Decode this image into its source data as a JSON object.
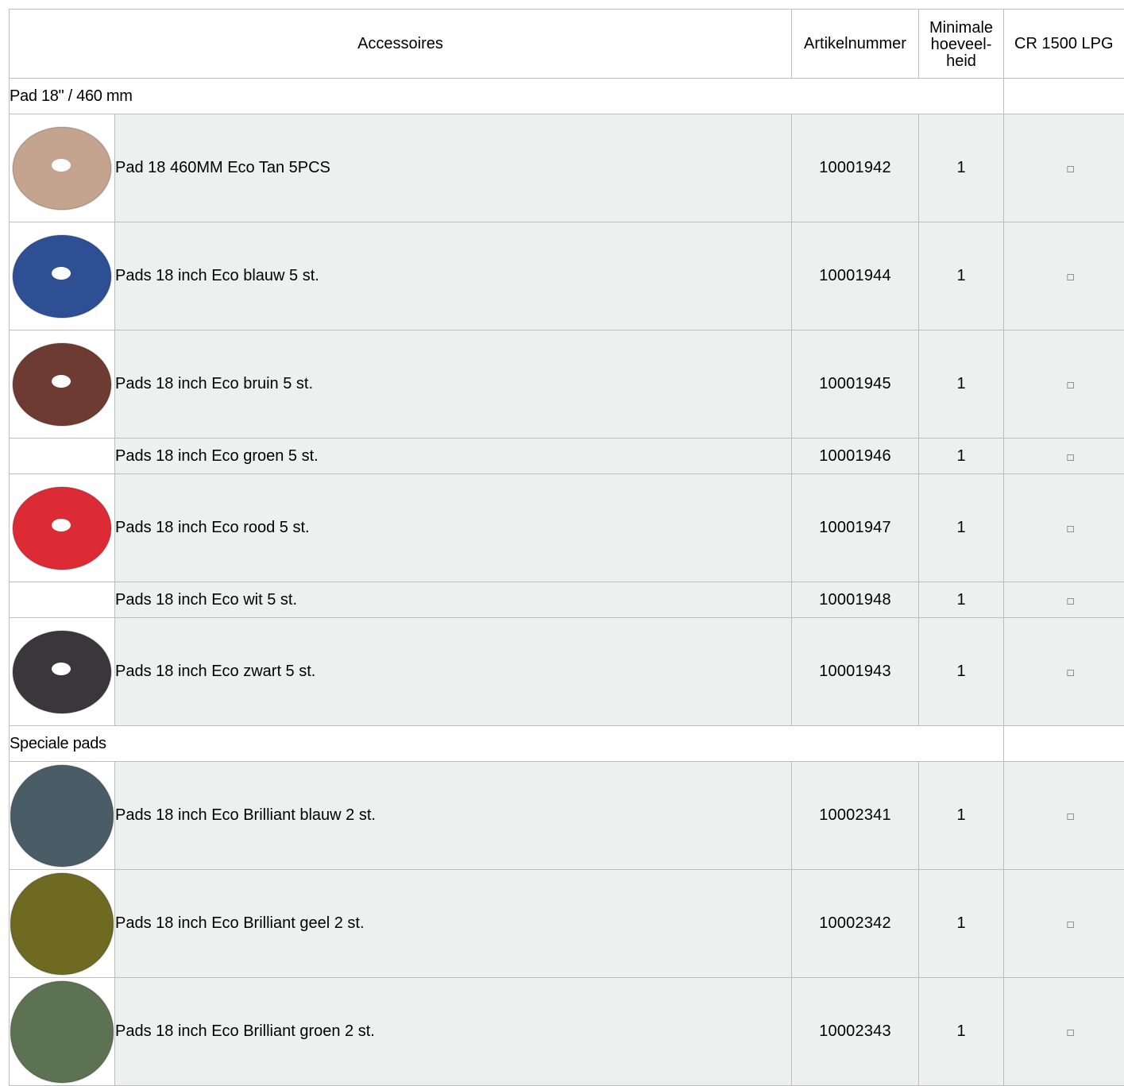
{
  "table": {
    "headers": {
      "accessories": "Accessoires",
      "article_number": "Artikelnummer",
      "min_qty": "Minimale hoeveel-heid",
      "model": "CR 1500 LPG"
    },
    "sections": [
      {
        "title": "Pad 18\" / 460 mm",
        "items": [
          {
            "description": "Pad 18 460MM  Eco Tan 5PCS",
            "article": "10001942",
            "qty": "1",
            "mark": "□",
            "pad_color": "#c4a38f",
            "has_image": true,
            "hole": true
          },
          {
            "description": "Pads 18 inch Eco blauw 5 st.",
            "article": "10001944",
            "qty": "1",
            "mark": "□",
            "pad_color": "#2f4f95",
            "has_image": true,
            "hole": true
          },
          {
            "description": "Pads 18 inch Eco bruin 5 st.",
            "article": "10001945",
            "qty": "1",
            "mark": "□",
            "pad_color": "#6e3b32",
            "has_image": true,
            "hole": true
          },
          {
            "description": "Pads 18 inch Eco groen 5 st.",
            "article": "10001946",
            "qty": "1",
            "mark": "□",
            "pad_color": "",
            "has_image": false,
            "hole": false
          },
          {
            "description": "Pads 18 inch Eco rood 5 st.",
            "article": "10001947",
            "qty": "1",
            "mark": "□",
            "pad_color": "#dc2b35",
            "has_image": true,
            "hole": true
          },
          {
            "description": "Pads 18 inch Eco wit 5 st.",
            "article": "10001948",
            "qty": "1",
            "mark": "□",
            "pad_color": "",
            "has_image": false,
            "hole": false
          },
          {
            "description": "Pads 18 inch Eco zwart 5 st.",
            "article": "10001943",
            "qty": "1",
            "mark": "□",
            "pad_color": "#3a373c",
            "has_image": true,
            "hole": true
          }
        ]
      },
      {
        "title": "Speciale pads",
        "items": [
          {
            "description": "Pads 18 inch Eco Brilliant blauw 2 st.",
            "article": "10002341",
            "qty": "1",
            "mark": "□",
            "pad_color": "#4a5c66",
            "has_image": true,
            "hole": false
          },
          {
            "description": "Pads 18 inch Eco Brilliant geel 2 st.",
            "article": "10002342",
            "qty": "1",
            "mark": "□",
            "pad_color": "#6e6a22",
            "has_image": true,
            "hole": false
          },
          {
            "description": "Pads 18 inch Eco Brilliant groen 2 st.",
            "article": "10002343",
            "qty": "1",
            "mark": "□",
            "pad_color": "#5c7252",
            "has_image": true,
            "hole": false
          }
        ]
      }
    ]
  }
}
